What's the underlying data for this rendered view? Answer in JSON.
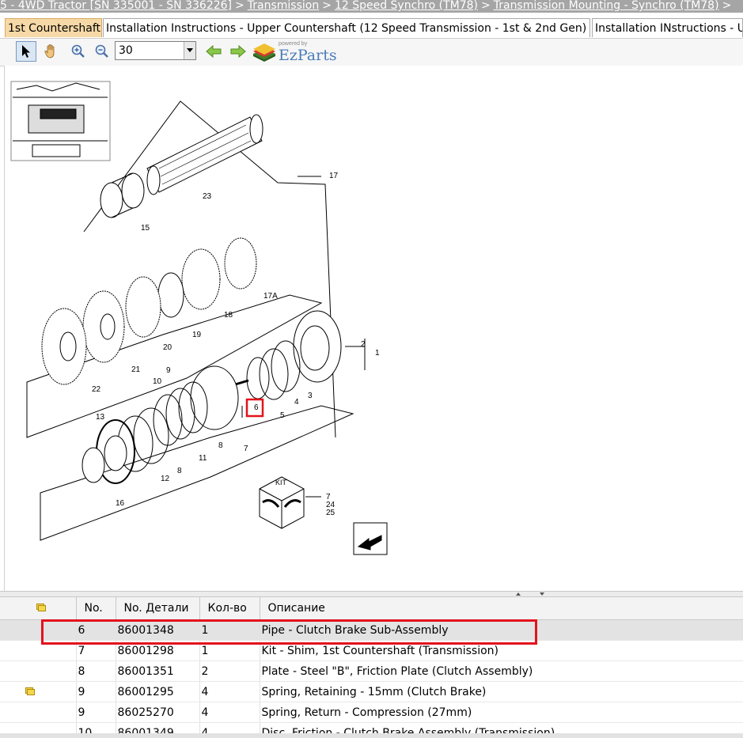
{
  "breadcrumb": [
    "5 - 4WD Tractor [SN 335001 - SN 336226]",
    "Transmission",
    "12 Speed Synchro (TM78)",
    "Transmission Mounting - Synchro (TM78)",
    ""
  ],
  "breadcrumb_separator": ">",
  "tabs": [
    {
      "label": "1st Countershaft",
      "active": true
    },
    {
      "label": "Installation Instructions - Upper Countershaft (12 Speed Transmission - 1st & 2nd Gen)",
      "active": false
    },
    {
      "label": "Installation INstructions - U",
      "active": false
    }
  ],
  "toolbar": {
    "zoom_value": "30",
    "logo_powered": "powered by",
    "logo_name": "EzParts"
  },
  "diagram": {
    "callouts": [
      "17",
      "23",
      "15",
      "17A",
      "18",
      "19",
      "20",
      "21",
      "22",
      "2",
      "1",
      "9",
      "10",
      "3",
      "4",
      "5",
      "6",
      "7",
      "8",
      "11",
      "12",
      "8",
      "13",
      "16",
      "7",
      "24",
      "25"
    ],
    "kit_label": "KIT",
    "highlighted_callout": "6"
  },
  "grid": {
    "columns": [
      "No.",
      "No. Детали",
      "Кол-во",
      "Описание"
    ],
    "rows": [
      {
        "no": "6",
        "part": "86001348",
        "qty": "1",
        "desc": "Pipe - Clutch Brake Sub-Assembly",
        "selected": true,
        "note": false
      },
      {
        "no": "7",
        "part": "86001298",
        "qty": "1",
        "desc": "Kit - Shim, 1st Countershaft (Transmission)",
        "selected": false,
        "note": false
      },
      {
        "no": "8",
        "part": "86001351",
        "qty": "2",
        "desc": "Plate - Steel \"B\", Friction Plate (Clutch Assembly)",
        "selected": false,
        "note": false
      },
      {
        "no": "9",
        "part": "86001295",
        "qty": "4",
        "desc": "Spring, Retaining - 15mm (Clutch Brake)",
        "selected": false,
        "note": true
      },
      {
        "no": "9",
        "part": "86025270",
        "qty": "4",
        "desc": "Spring, Return - Compression (27mm)",
        "selected": false,
        "note": false
      },
      {
        "no": "10",
        "part": "86001349",
        "qty": "4",
        "desc": "Disc, Friction - Clutch Brake Assembly (Transmission)",
        "selected": false,
        "note": false
      }
    ]
  },
  "colors": {
    "tab_active": "#f6d9a6",
    "highlight": "#e3121c",
    "selected_row": "#e3e3e3",
    "breadcrumb_bg": "#a5a5a5"
  }
}
